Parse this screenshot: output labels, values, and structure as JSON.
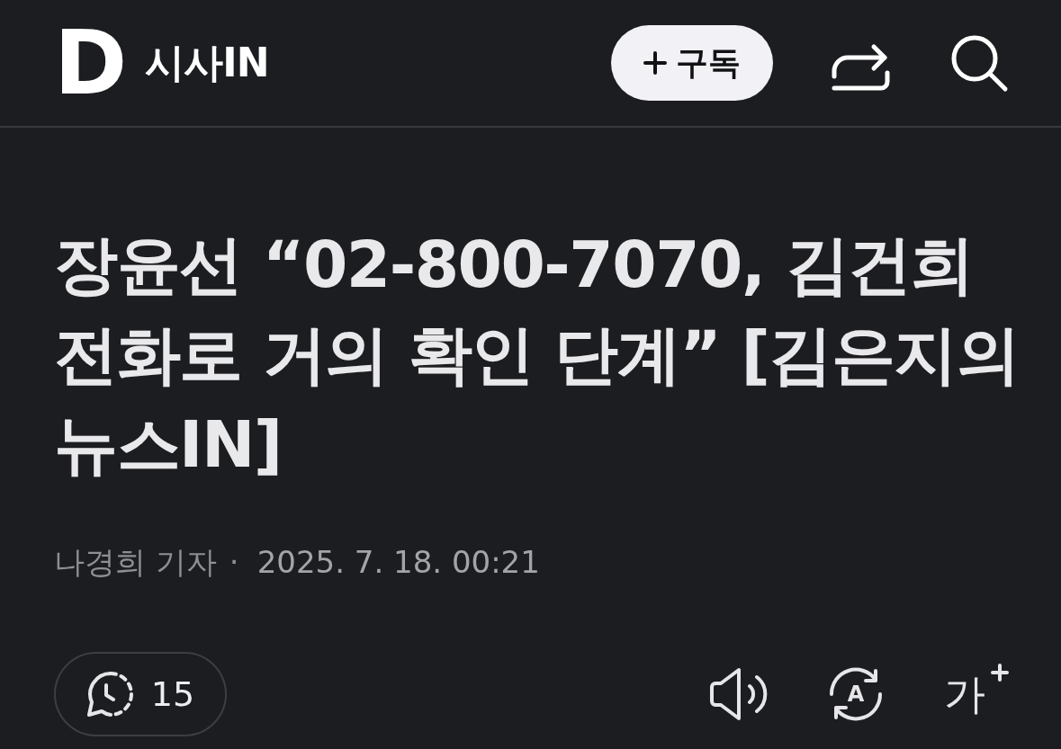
{
  "header": {
    "logo_letter": "D",
    "site_name": "시사IN",
    "subscribe_button": {
      "label": "구독"
    }
  },
  "article": {
    "title": "장윤선 “02-800-7070, 김건희 전화로 거의 확인 단계” [김은지의 뉴스IN]",
    "byline": {
      "author": "나경희 기자",
      "separator": "·",
      "date": "2025. 7. 18. 00:21"
    }
  },
  "toolbar": {
    "comments": {
      "count": "15"
    },
    "translate_button": {
      "label": "A"
    },
    "font_size_button": {
      "label": "가"
    }
  }
}
